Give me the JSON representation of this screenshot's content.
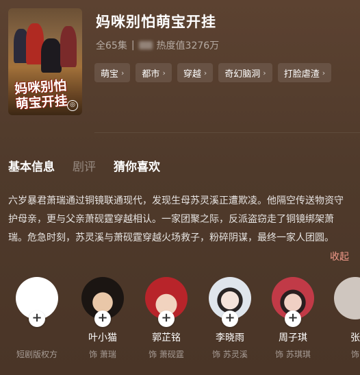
{
  "drama": {
    "title": "妈咪别怕萌宝开挂",
    "poster_caption": "妈咪别怕萌宝开挂",
    "episodes": "全65集",
    "separator": "|",
    "heat": "热度值3276万"
  },
  "tags": [
    {
      "label": "萌宝"
    },
    {
      "label": "都市"
    },
    {
      "label": "穿越"
    },
    {
      "label": "奇幻脑洞"
    },
    {
      "label": "打脸虐渣"
    }
  ],
  "tabs": [
    {
      "label": "基本信息",
      "active": true
    },
    {
      "label": "剧评",
      "active": false
    },
    {
      "label": "猜你喜欢",
      "active": false
    }
  ],
  "description": {
    "text": "六岁暴君萧瑞通过铜镜联通现代，发现生母苏灵溪正遭欺凌。他隔空传送物资守护母亲，更与父亲萧砚霆穿越相认。一家团聚之际，反派盗窃走了铜镜绑架萧瑞。危急时刻，苏灵溪与萧砚霆穿越火场救子，粉碎阴谋，最终一家人团圆。",
    "collapse_label": "收起"
  },
  "cast": [
    {
      "name": "",
      "role": "短剧版权方"
    },
    {
      "name": "叶小猫",
      "role": "饰 萧瑞"
    },
    {
      "name": "郭芷铭",
      "role": "饰 萧砚霆"
    },
    {
      "name": "李晓雨",
      "role": "饰 苏灵溪"
    },
    {
      "name": "周子琪",
      "role": "饰 苏琪琪"
    },
    {
      "name": "张",
      "role": "饰"
    }
  ],
  "icons": {
    "tag_chevron": "chevron-right-icon",
    "follow": "plus-icon",
    "poster_badge": "badge-icon"
  },
  "colors": {
    "background": "#5c4231",
    "collapse_link": "#f29a8a"
  }
}
